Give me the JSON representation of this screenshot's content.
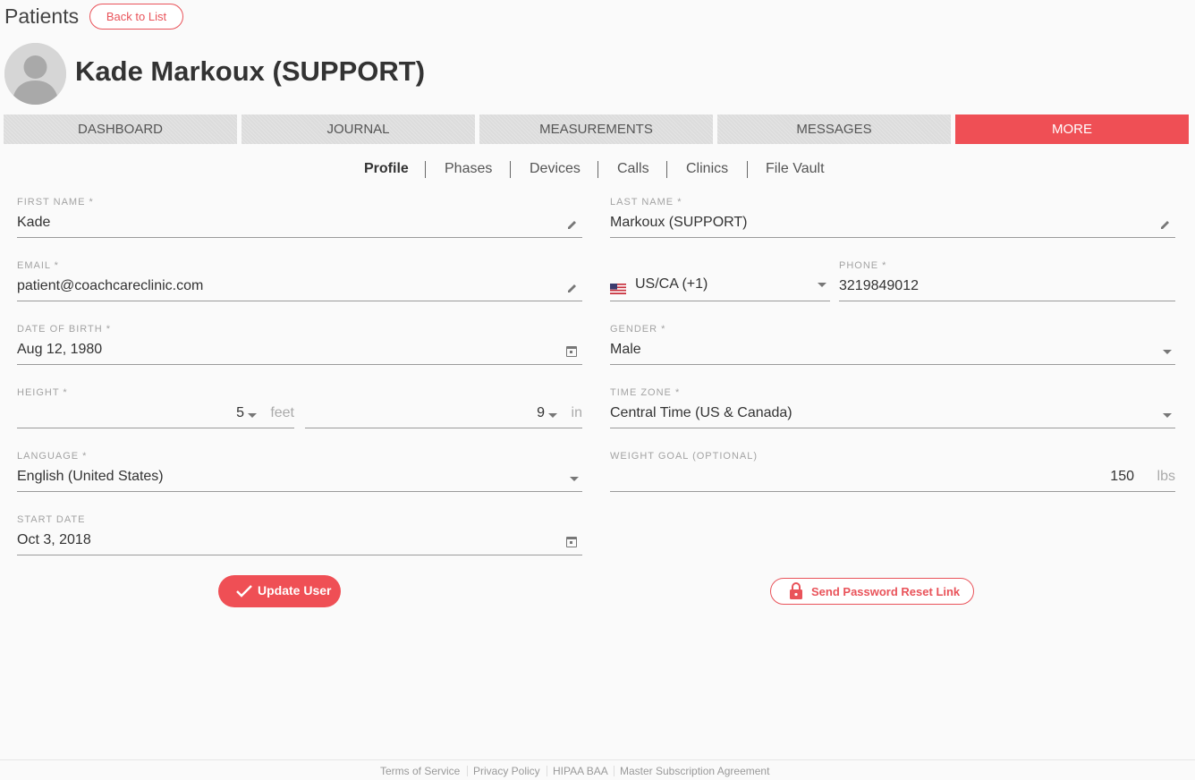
{
  "header": {
    "section_title": "Patients",
    "back_label": "Back to List",
    "patient_name": "Kade Markoux (SUPPORT)"
  },
  "tabs": [
    {
      "label": "DASHBOARD"
    },
    {
      "label": "JOURNAL"
    },
    {
      "label": "MEASUREMENTS"
    },
    {
      "label": "MESSAGES"
    },
    {
      "label": "MORE",
      "active": true
    }
  ],
  "subnav": [
    {
      "label": "Profile",
      "active": true
    },
    {
      "label": "Phases"
    },
    {
      "label": "Devices"
    },
    {
      "label": "Calls"
    },
    {
      "label": "Clinics"
    },
    {
      "label": "File Vault"
    }
  ],
  "form": {
    "first_name": {
      "label": "FIRST NAME *",
      "value": "Kade"
    },
    "last_name": {
      "label": "LAST NAME *",
      "value": "Markoux (SUPPORT)"
    },
    "email": {
      "label": "EMAIL *",
      "value": "patient@coachcareclinic.com"
    },
    "country_code": {
      "value": "US/CA (+1)"
    },
    "phone": {
      "label": "PHONE *",
      "value": "3219849012"
    },
    "dob": {
      "label": "DATE OF BIRTH *",
      "value": "Aug 12, 1980"
    },
    "gender": {
      "label": "GENDER *",
      "value": "Male"
    },
    "height": {
      "label": "HEIGHT *",
      "feet": "5",
      "feet_unit": "feet",
      "inches": "9",
      "inches_unit": "in"
    },
    "timezone": {
      "label": "TIME ZONE *",
      "value": "Central Time (US & Canada)"
    },
    "language": {
      "label": "LANGUAGE *",
      "value": "English (United States)"
    },
    "weight_goal": {
      "label": "WEIGHT GOAL (OPTIONAL)",
      "value": "150",
      "unit": "lbs"
    },
    "start_date": {
      "label": "START DATE",
      "value": "Oct 3, 2018"
    }
  },
  "actions": {
    "update_label": "Update User",
    "reset_label": "Send Password Reset Link"
  },
  "footer": {
    "links": [
      "Terms of Service",
      "Privacy Policy",
      "HIPAA BAA",
      "Master Subscription Agreement"
    ]
  },
  "colors": {
    "accent": "#ef4f55",
    "tab_inactive": "#dcdcdc"
  },
  "icons": [
    "avatar-icon",
    "pencil-icon",
    "calendar-icon",
    "caret-down-icon",
    "us-flag-icon",
    "check-icon",
    "lock-icon"
  ]
}
